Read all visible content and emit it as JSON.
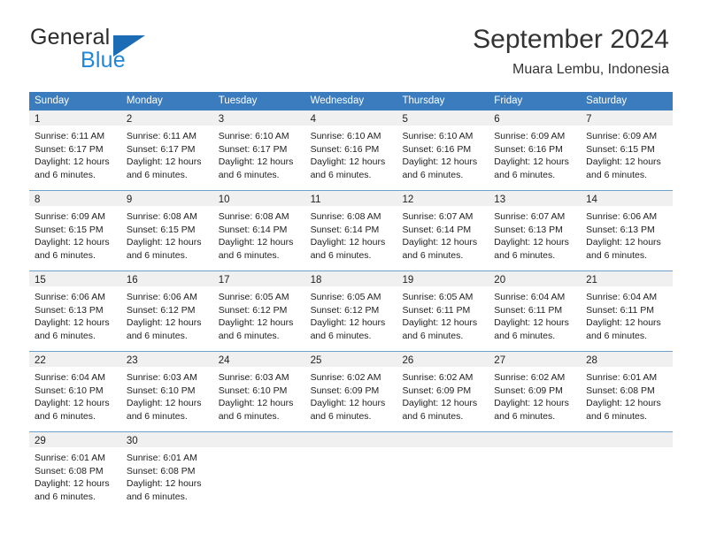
{
  "brand": {
    "name_part1": "General",
    "name_part2": "Blue",
    "flag_icon": "triangle-flag-icon",
    "accent_dark": "#1b6cb5",
    "accent_light": "#1f87d8"
  },
  "header": {
    "title": "September 2024",
    "subtitle": "Muara Lembu, Indonesia"
  },
  "theme": {
    "header_row_bg": "#3a7cbe",
    "header_row_text": "#ffffff",
    "day_band_bg": "#f0f0f0",
    "row_divider": "#6f9fcb",
    "body_text": "#222222"
  },
  "weekdays": [
    "Sunday",
    "Monday",
    "Tuesday",
    "Wednesday",
    "Thursday",
    "Friday",
    "Saturday"
  ],
  "weeks": [
    [
      {
        "day": "1",
        "sunrise": "Sunrise: 6:11 AM",
        "sunset": "Sunset: 6:17 PM",
        "daylight_line1": "Daylight: 12 hours",
        "daylight_line2": "and 6 minutes."
      },
      {
        "day": "2",
        "sunrise": "Sunrise: 6:11 AM",
        "sunset": "Sunset: 6:17 PM",
        "daylight_line1": "Daylight: 12 hours",
        "daylight_line2": "and 6 minutes."
      },
      {
        "day": "3",
        "sunrise": "Sunrise: 6:10 AM",
        "sunset": "Sunset: 6:17 PM",
        "daylight_line1": "Daylight: 12 hours",
        "daylight_line2": "and 6 minutes."
      },
      {
        "day": "4",
        "sunrise": "Sunrise: 6:10 AM",
        "sunset": "Sunset: 6:16 PM",
        "daylight_line1": "Daylight: 12 hours",
        "daylight_line2": "and 6 minutes."
      },
      {
        "day": "5",
        "sunrise": "Sunrise: 6:10 AM",
        "sunset": "Sunset: 6:16 PM",
        "daylight_line1": "Daylight: 12 hours",
        "daylight_line2": "and 6 minutes."
      },
      {
        "day": "6",
        "sunrise": "Sunrise: 6:09 AM",
        "sunset": "Sunset: 6:16 PM",
        "daylight_line1": "Daylight: 12 hours",
        "daylight_line2": "and 6 minutes."
      },
      {
        "day": "7",
        "sunrise": "Sunrise: 6:09 AM",
        "sunset": "Sunset: 6:15 PM",
        "daylight_line1": "Daylight: 12 hours",
        "daylight_line2": "and 6 minutes."
      }
    ],
    [
      {
        "day": "8",
        "sunrise": "Sunrise: 6:09 AM",
        "sunset": "Sunset: 6:15 PM",
        "daylight_line1": "Daylight: 12 hours",
        "daylight_line2": "and 6 minutes."
      },
      {
        "day": "9",
        "sunrise": "Sunrise: 6:08 AM",
        "sunset": "Sunset: 6:15 PM",
        "daylight_line1": "Daylight: 12 hours",
        "daylight_line2": "and 6 minutes."
      },
      {
        "day": "10",
        "sunrise": "Sunrise: 6:08 AM",
        "sunset": "Sunset: 6:14 PM",
        "daylight_line1": "Daylight: 12 hours",
        "daylight_line2": "and 6 minutes."
      },
      {
        "day": "11",
        "sunrise": "Sunrise: 6:08 AM",
        "sunset": "Sunset: 6:14 PM",
        "daylight_line1": "Daylight: 12 hours",
        "daylight_line2": "and 6 minutes."
      },
      {
        "day": "12",
        "sunrise": "Sunrise: 6:07 AM",
        "sunset": "Sunset: 6:14 PM",
        "daylight_line1": "Daylight: 12 hours",
        "daylight_line2": "and 6 minutes."
      },
      {
        "day": "13",
        "sunrise": "Sunrise: 6:07 AM",
        "sunset": "Sunset: 6:13 PM",
        "daylight_line1": "Daylight: 12 hours",
        "daylight_line2": "and 6 minutes."
      },
      {
        "day": "14",
        "sunrise": "Sunrise: 6:06 AM",
        "sunset": "Sunset: 6:13 PM",
        "daylight_line1": "Daylight: 12 hours",
        "daylight_line2": "and 6 minutes."
      }
    ],
    [
      {
        "day": "15",
        "sunrise": "Sunrise: 6:06 AM",
        "sunset": "Sunset: 6:13 PM",
        "daylight_line1": "Daylight: 12 hours",
        "daylight_line2": "and 6 minutes."
      },
      {
        "day": "16",
        "sunrise": "Sunrise: 6:06 AM",
        "sunset": "Sunset: 6:12 PM",
        "daylight_line1": "Daylight: 12 hours",
        "daylight_line2": "and 6 minutes."
      },
      {
        "day": "17",
        "sunrise": "Sunrise: 6:05 AM",
        "sunset": "Sunset: 6:12 PM",
        "daylight_line1": "Daylight: 12 hours",
        "daylight_line2": "and 6 minutes."
      },
      {
        "day": "18",
        "sunrise": "Sunrise: 6:05 AM",
        "sunset": "Sunset: 6:12 PM",
        "daylight_line1": "Daylight: 12 hours",
        "daylight_line2": "and 6 minutes."
      },
      {
        "day": "19",
        "sunrise": "Sunrise: 6:05 AM",
        "sunset": "Sunset: 6:11 PM",
        "daylight_line1": "Daylight: 12 hours",
        "daylight_line2": "and 6 minutes."
      },
      {
        "day": "20",
        "sunrise": "Sunrise: 6:04 AM",
        "sunset": "Sunset: 6:11 PM",
        "daylight_line1": "Daylight: 12 hours",
        "daylight_line2": "and 6 minutes."
      },
      {
        "day": "21",
        "sunrise": "Sunrise: 6:04 AM",
        "sunset": "Sunset: 6:11 PM",
        "daylight_line1": "Daylight: 12 hours",
        "daylight_line2": "and 6 minutes."
      }
    ],
    [
      {
        "day": "22",
        "sunrise": "Sunrise: 6:04 AM",
        "sunset": "Sunset: 6:10 PM",
        "daylight_line1": "Daylight: 12 hours",
        "daylight_line2": "and 6 minutes."
      },
      {
        "day": "23",
        "sunrise": "Sunrise: 6:03 AM",
        "sunset": "Sunset: 6:10 PM",
        "daylight_line1": "Daylight: 12 hours",
        "daylight_line2": "and 6 minutes."
      },
      {
        "day": "24",
        "sunrise": "Sunrise: 6:03 AM",
        "sunset": "Sunset: 6:10 PM",
        "daylight_line1": "Daylight: 12 hours",
        "daylight_line2": "and 6 minutes."
      },
      {
        "day": "25",
        "sunrise": "Sunrise: 6:02 AM",
        "sunset": "Sunset: 6:09 PM",
        "daylight_line1": "Daylight: 12 hours",
        "daylight_line2": "and 6 minutes."
      },
      {
        "day": "26",
        "sunrise": "Sunrise: 6:02 AM",
        "sunset": "Sunset: 6:09 PM",
        "daylight_line1": "Daylight: 12 hours",
        "daylight_line2": "and 6 minutes."
      },
      {
        "day": "27",
        "sunrise": "Sunrise: 6:02 AM",
        "sunset": "Sunset: 6:09 PM",
        "daylight_line1": "Daylight: 12 hours",
        "daylight_line2": "and 6 minutes."
      },
      {
        "day": "28",
        "sunrise": "Sunrise: 6:01 AM",
        "sunset": "Sunset: 6:08 PM",
        "daylight_line1": "Daylight: 12 hours",
        "daylight_line2": "and 6 minutes."
      }
    ],
    [
      {
        "day": "29",
        "sunrise": "Sunrise: 6:01 AM",
        "sunset": "Sunset: 6:08 PM",
        "daylight_line1": "Daylight: 12 hours",
        "daylight_line2": "and 6 minutes."
      },
      {
        "day": "30",
        "sunrise": "Sunrise: 6:01 AM",
        "sunset": "Sunset: 6:08 PM",
        "daylight_line1": "Daylight: 12 hours",
        "daylight_line2": "and 6 minutes."
      },
      {
        "day": "",
        "sunrise": "",
        "sunset": "",
        "daylight_line1": "",
        "daylight_line2": ""
      },
      {
        "day": "",
        "sunrise": "",
        "sunset": "",
        "daylight_line1": "",
        "daylight_line2": ""
      },
      {
        "day": "",
        "sunrise": "",
        "sunset": "",
        "daylight_line1": "",
        "daylight_line2": ""
      },
      {
        "day": "",
        "sunrise": "",
        "sunset": "",
        "daylight_line1": "",
        "daylight_line2": ""
      },
      {
        "day": "",
        "sunrise": "",
        "sunset": "",
        "daylight_line1": "",
        "daylight_line2": ""
      }
    ]
  ]
}
